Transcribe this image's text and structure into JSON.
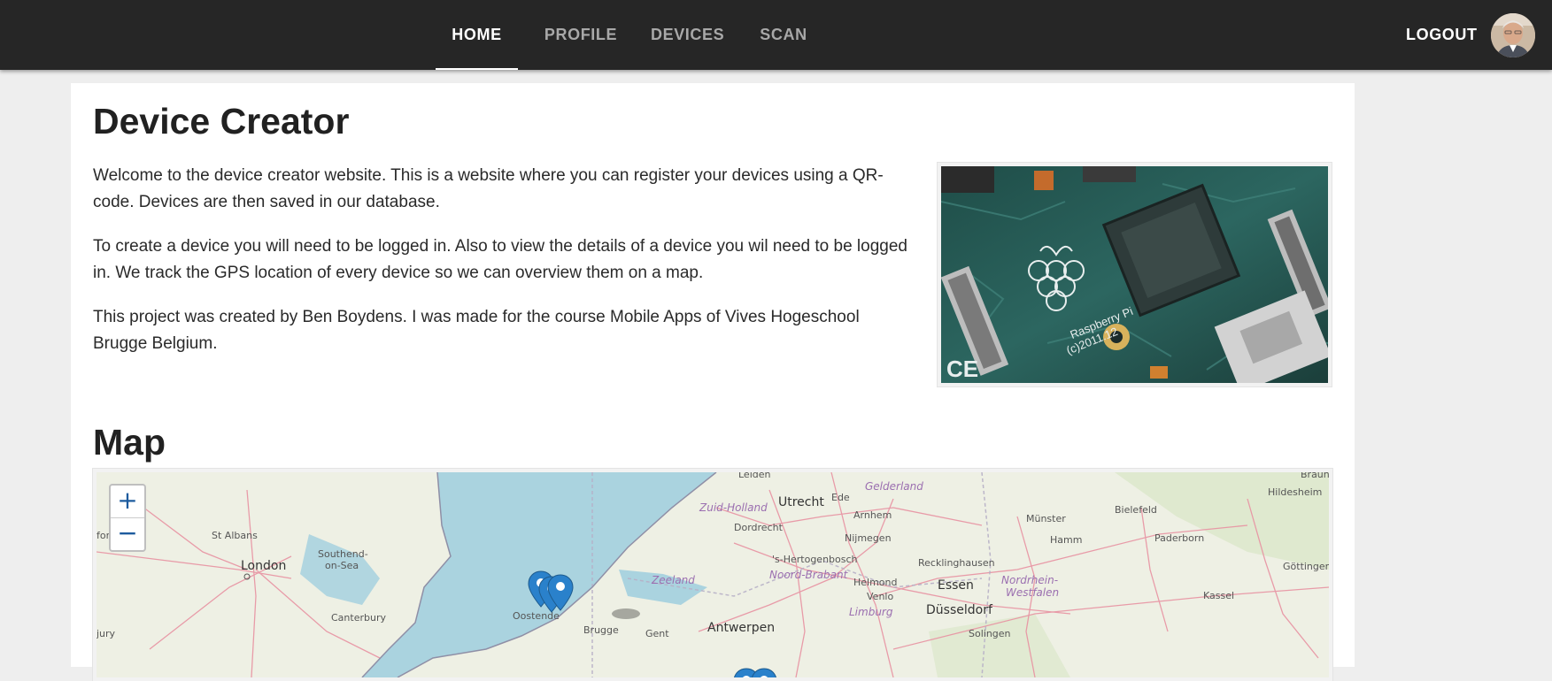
{
  "nav": {
    "tabs": [
      {
        "label": "HOME",
        "active": true
      },
      {
        "label": "PROFILE",
        "active": false
      },
      {
        "label": "DEVICES",
        "active": false
      },
      {
        "label": "SCAN",
        "active": false
      }
    ],
    "logout_label": "LOGOUT"
  },
  "main": {
    "title": "Device Creator",
    "paragraphs": [
      "Welcome to the device creator website. This is a website where you can register your devices using a QR-code. Devices are then saved in our database.",
      "To create a device you will need to be logged in. Also to view the details of a device you wil need to be logged in. We track the GPS location of every device so we can overview them on a map.",
      "This project was created by Ben Boydens. I was made for the course Mobile Apps of Vives Hogeschool Brugge Belgium."
    ],
    "photo_logo_text": "Raspberry Pi",
    "photo_copyright": "(c)2011.12"
  },
  "map": {
    "title": "Map",
    "zoom_in": "+",
    "zoom_out": "−",
    "labels": {
      "leiden": "Leiden",
      "gelderland": "Gelderland",
      "hildesheim": "Hildesheim",
      "braun": "Braun",
      "zuid_holland": "Zuid-Holland",
      "utrecht": "Utrecht",
      "ede": "Ede",
      "arnhem": "Arnhem",
      "munster": "Münster",
      "bielefeld": "Bielefeld",
      "ford": "ford",
      "st_albans": "St Albans",
      "dordrecht": "Dordrecht",
      "nijmegen": "Nijmegen",
      "hamm": "Hamm",
      "paderborn": "Paderborn",
      "london": "London",
      "southend": "Southend-",
      "on_sea": "on-Sea",
      "hertogenbosch": "'s-Hertogenbosch",
      "recklinghausen": "Recklinghausen",
      "gottingen": "Göttingen",
      "zeeland": "Zeeland",
      "noord_brabant": "Noord-Brabant",
      "helmond": "Helmond",
      "essen": "Essen",
      "nordrhein": "Nordrhein-",
      "westfalen": "Westfalen",
      "kassel": "Kassel",
      "canterbury": "Canterbury",
      "oostende": "Oostende",
      "venlo": "Venlo",
      "limburg": "Limburg",
      "dusseldorf": "Düsseldorf",
      "brugge": "Brugge",
      "gent": "Gent",
      "antwerpen": "Antwerpen",
      "jury": "jury",
      "solingen": "Solingen"
    }
  }
}
